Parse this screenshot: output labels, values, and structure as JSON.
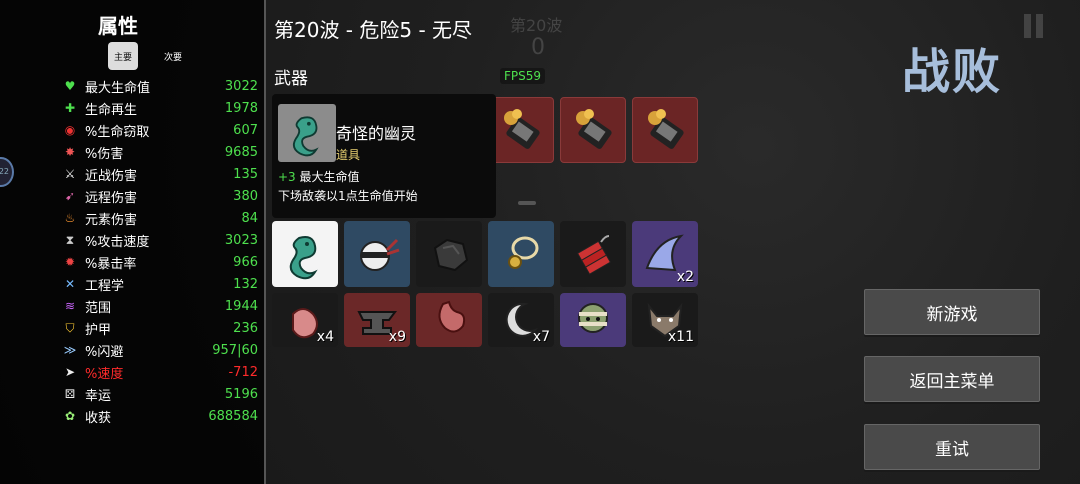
{
  "stats": {
    "title": "属性",
    "tab_main": "主要",
    "tab_sub": "次要",
    "rows": [
      {
        "icon": "heart-icon",
        "glyph": "♥",
        "color": "#4ee04e",
        "label": "最大生命值",
        "value": "3022"
      },
      {
        "icon": "regen-icon",
        "glyph": "✚",
        "color": "#4ee04e",
        "label": "生命再生",
        "value": "1978"
      },
      {
        "icon": "lifesteal-icon",
        "glyph": "◉",
        "color": "#e33",
        "label": "%生命窃取",
        "value": "607"
      },
      {
        "icon": "damage-icon",
        "glyph": "✸",
        "color": "#e55",
        "label": "%伤害",
        "value": "9685"
      },
      {
        "icon": "melee-icon",
        "glyph": "⚔",
        "color": "#eee",
        "label": "近战伤害",
        "value": "135"
      },
      {
        "icon": "ranged-icon",
        "glyph": "➹",
        "color": "#d6a",
        "label": "远程伤害",
        "value": "380"
      },
      {
        "icon": "elemental-icon",
        "glyph": "♨",
        "color": "#f93",
        "label": "元素伤害",
        "value": "84"
      },
      {
        "icon": "attack-speed-icon",
        "glyph": "⧗",
        "color": "#ccc",
        "label": "%攻击速度",
        "value": "3023"
      },
      {
        "icon": "crit-icon",
        "glyph": "✹",
        "color": "#e44",
        "label": "%暴击率",
        "value": "966"
      },
      {
        "icon": "engineering-icon",
        "glyph": "✕",
        "color": "#7bf",
        "label": "工程学",
        "value": "132"
      },
      {
        "icon": "range-icon",
        "glyph": "≋",
        "color": "#c6f",
        "label": "范围",
        "value": "1944"
      },
      {
        "icon": "armor-icon",
        "glyph": "⛉",
        "color": "#fc3",
        "label": "护甲",
        "value": "236"
      },
      {
        "icon": "dodge-icon",
        "glyph": "≫",
        "color": "#9cf",
        "label": "%闪避",
        "value": "957|60"
      },
      {
        "icon": "speed-icon",
        "glyph": "➤",
        "color": "#eee",
        "label": "%速度",
        "value": "-712",
        "negative": true
      },
      {
        "icon": "luck-icon",
        "glyph": "⚄",
        "color": "#eee",
        "label": "幸运",
        "value": "5196"
      },
      {
        "icon": "harvest-icon",
        "glyph": "✿",
        "color": "#9e7",
        "label": "收获",
        "value": "688584"
      }
    ]
  },
  "header": {
    "wave_title": "第20波 - 危险5 - 无尽",
    "ghost_wave": "第20波",
    "ghost_count": "0",
    "fps": "FPS59",
    "weapons_label": "武器"
  },
  "tooltip": {
    "name": "奇怪的幽灵",
    "type": "道具",
    "effect_plus": "+3",
    "effect_text": " 最大生命值",
    "note": "下场敌袭以1点生命值开始"
  },
  "items": {
    "row1": [
      {
        "name": "item-strange-ghost",
        "qty": ""
      },
      {
        "name": "item-ninja-bandana",
        "qty": ""
      },
      {
        "name": "item-coal",
        "qty": ""
      },
      {
        "name": "item-pendant",
        "qty": ""
      },
      {
        "name": "item-dynamite",
        "qty": ""
      },
      {
        "name": "item-shark-fin",
        "qty": "x2"
      }
    ],
    "row2": [
      {
        "name": "item-pink-flesh",
        "qty": "x4"
      },
      {
        "name": "item-anvil",
        "qty": "x9"
      },
      {
        "name": "item-stomach",
        "qty": ""
      },
      {
        "name": "item-crescent",
        "qty": "x7"
      },
      {
        "name": "item-mummy",
        "qty": ""
      },
      {
        "name": "item-werewolf",
        "qty": "x11"
      }
    ]
  },
  "right": {
    "defeat_text": "战败",
    "new_game": "新游戏",
    "main_menu": "返回主菜单",
    "retry": "重试"
  }
}
